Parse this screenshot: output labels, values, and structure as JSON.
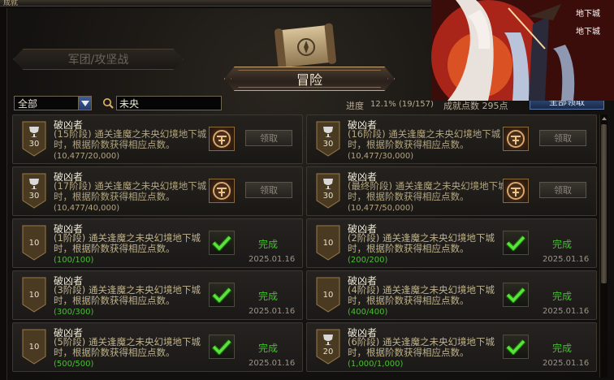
{
  "window": {
    "title": "成就"
  },
  "tabs": {
    "left_label": "军团/攻坚战",
    "main_label": "冒险"
  },
  "filter": {
    "category_value": "全部",
    "search_value": "未央"
  },
  "progress": {
    "label": "进度",
    "value_text": "12.1% (19/157)",
    "points_text": "成就点数 295点",
    "claim_all_label": "全部领取"
  },
  "colors": {
    "done_green": "#3fc22a",
    "gold": "#c9a876"
  },
  "achievements": [
    {
      "title": "破凶者",
      "desc": "(15阶段) 通关逢魔之未央幻境地下城时，根据阶数获得相应点数。",
      "progress": "(10,477/20,000)",
      "points": "30",
      "badge": "silver-trophy",
      "status": "claim",
      "button": "领取",
      "date": ""
    },
    {
      "title": "破凶者",
      "desc": "(16阶段) 通关逢魔之未央幻境地下城时，根据阶数获得相应点数。",
      "progress": "(10,477/30,000)",
      "points": "30",
      "badge": "silver-trophy",
      "status": "claim",
      "button": "领取",
      "date": ""
    },
    {
      "title": "破凶者",
      "desc": "(17阶段) 通关逢魔之未央幻境地下城时，根据阶数获得相应点数。",
      "progress": "(10,477/40,000)",
      "points": "30",
      "badge": "silver-trophy",
      "status": "claim",
      "button": "领取",
      "date": ""
    },
    {
      "title": "破凶者",
      "desc": "(最终阶段) 通关逢魔之未央幻境地下城时，根据阶数获得相应点数。",
      "progress": "(10,477/50,000)",
      "points": "30",
      "badge": "silver-trophy",
      "status": "claim",
      "button": "领取",
      "date": ""
    },
    {
      "title": "破凶者",
      "desc": "(1阶段) 通关逢魔之未央幻境地下城时，根据阶数获得相应点数。",
      "progress": "(100/100)",
      "points": "10",
      "badge": "bronze",
      "status": "done",
      "button": "完成",
      "date": "2025.01.16"
    },
    {
      "title": "破凶者",
      "desc": "(2阶段) 通关逢魔之未央幻境地下城时，根据阶数获得相应点数。",
      "progress": "(200/200)",
      "points": "10",
      "badge": "bronze",
      "status": "done",
      "button": "完成",
      "date": "2025.01.16"
    },
    {
      "title": "破凶者",
      "desc": "(3阶段) 通关逢魔之未央幻境地下城时，根据阶数获得相应点数。",
      "progress": "(300/300)",
      "points": "10",
      "badge": "bronze",
      "status": "done",
      "button": "完成",
      "date": "2025.01.16"
    },
    {
      "title": "破凶者",
      "desc": "(4阶段) 通关逢魔之未央幻境地下城时，根据阶数获得相应点数。",
      "progress": "(400/400)",
      "points": "10",
      "badge": "bronze",
      "status": "done",
      "button": "完成",
      "date": "2025.01.16"
    },
    {
      "title": "破凶者",
      "desc": "(5阶段) 通关逢魔之未央幻境地下城时，根据阶数获得相应点数。",
      "progress": "(500/500)",
      "points": "10",
      "badge": "bronze",
      "status": "done",
      "button": "完成",
      "date": "2025.01.16"
    },
    {
      "title": "破凶者",
      "desc": "(6阶段) 通关逢魔之未央幻境地下城时，根据阶数获得相应点数。",
      "progress": "(1,000/1,000)",
      "points": "20",
      "badge": "silver-trophy",
      "status": "done",
      "button": "完成",
      "date": "2025.01.16"
    }
  ]
}
